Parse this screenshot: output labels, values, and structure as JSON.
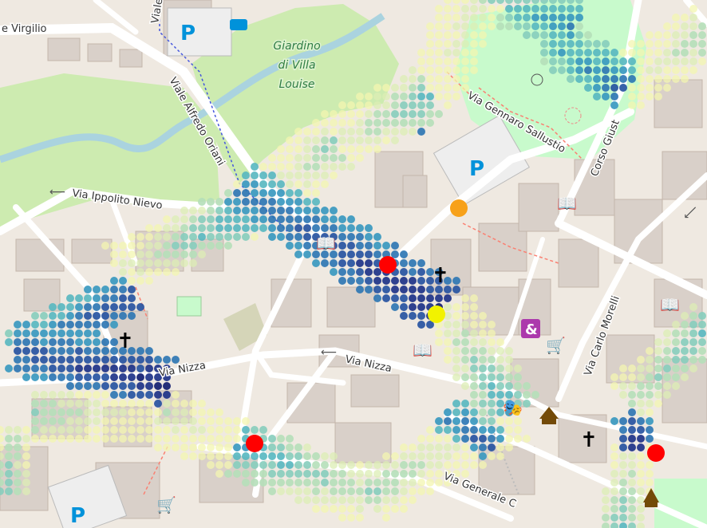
{
  "map": {
    "street_labels": [
      {
        "id": "via-virgilio",
        "text": "e Virgilio"
      },
      {
        "id": "viale-top",
        "text": "Viale"
      },
      {
        "id": "viale-alfredo-oriani",
        "text": "Viale Alfredo Oriani"
      },
      {
        "id": "via-ippolito-nievo",
        "text": "Via Ippolito Nievo"
      },
      {
        "id": "via-gennaro-sallustio",
        "text": "Via Gennaro Sallustio"
      },
      {
        "id": "corso-giusti",
        "text": "Corso Giust"
      },
      {
        "id": "via-nizza-west",
        "text": "Via Nizza"
      },
      {
        "id": "via-nizza-east",
        "text": "Via Nizza"
      },
      {
        "id": "via-carlo-morelli",
        "text": "Via Carlo Morelli"
      },
      {
        "id": "via-generale",
        "text": "Via Generale C"
      }
    ],
    "park_label": [
      "Giardino",
      "di Villa",
      "Louise"
    ],
    "symbols": {
      "parking": "P",
      "church": "✝",
      "book": "📖",
      "shop": "🛒",
      "theatre": "🎭",
      "gift": "&"
    },
    "markers": [
      {
        "id": "marker-red-1",
        "color": "#ff0000"
      },
      {
        "id": "marker-red-2",
        "color": "#ff0000"
      },
      {
        "id": "marker-red-3",
        "color": "#ff0000"
      },
      {
        "id": "marker-orange",
        "color": "#f7a11a"
      },
      {
        "id": "marker-yellow",
        "color": "#f2f200"
      }
    ],
    "colors": {
      "land": "#efe9e1",
      "park": "#cdebb0",
      "garden": "#c8facc",
      "water": "#aad3df",
      "building": "#d9d0c9",
      "road": "#ffffff",
      "heat_low": "#f3f6b0",
      "heat_high": "#0d1a6e"
    }
  }
}
